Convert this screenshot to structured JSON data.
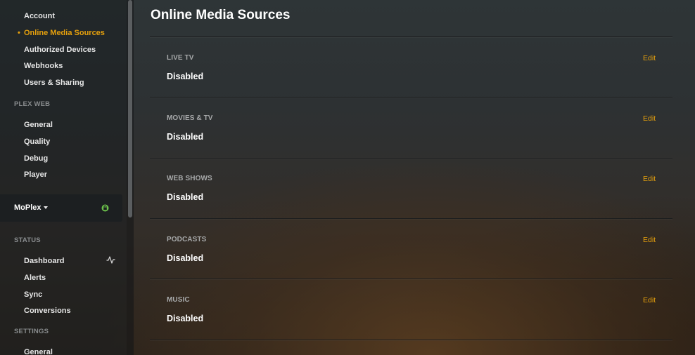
{
  "sidebar": {
    "account_items": [
      {
        "label": "Account",
        "active": false
      },
      {
        "label": "Online Media Sources",
        "active": true
      },
      {
        "label": "Authorized Devices",
        "active": false
      },
      {
        "label": "Webhooks",
        "active": false
      },
      {
        "label": "Users & Sharing",
        "active": false
      }
    ],
    "active_bullet": "•",
    "plex_web": {
      "heading": "PLEX WEB",
      "items": [
        "General",
        "Quality",
        "Debug",
        "Player"
      ]
    },
    "server": {
      "name": "MoPlex"
    },
    "status": {
      "heading": "STATUS",
      "items": [
        "Dashboard",
        "Alerts",
        "Sync",
        "Conversions"
      ]
    },
    "settings": {
      "heading": "SETTINGS",
      "items": [
        "General"
      ]
    }
  },
  "main": {
    "title": "Online Media Sources",
    "sources": [
      {
        "label": "LIVE TV",
        "status": "Disabled",
        "edit": "Edit"
      },
      {
        "label": "MOVIES & TV",
        "status": "Disabled",
        "edit": "Edit"
      },
      {
        "label": "WEB SHOWS",
        "status": "Disabled",
        "edit": "Edit"
      },
      {
        "label": "PODCASTS",
        "status": "Disabled",
        "edit": "Edit"
      },
      {
        "label": "MUSIC",
        "status": "Disabled",
        "edit": "Edit"
      }
    ]
  },
  "colors": {
    "accent": "#e5a00d",
    "server_online": "#6bc04b",
    "text_primary": "#ffffff",
    "text_muted": "#a7a9aa"
  },
  "icons": {
    "server_status": "lock-icon",
    "dashboard": "activity-icon",
    "server_menu": "caret-down-icon"
  }
}
